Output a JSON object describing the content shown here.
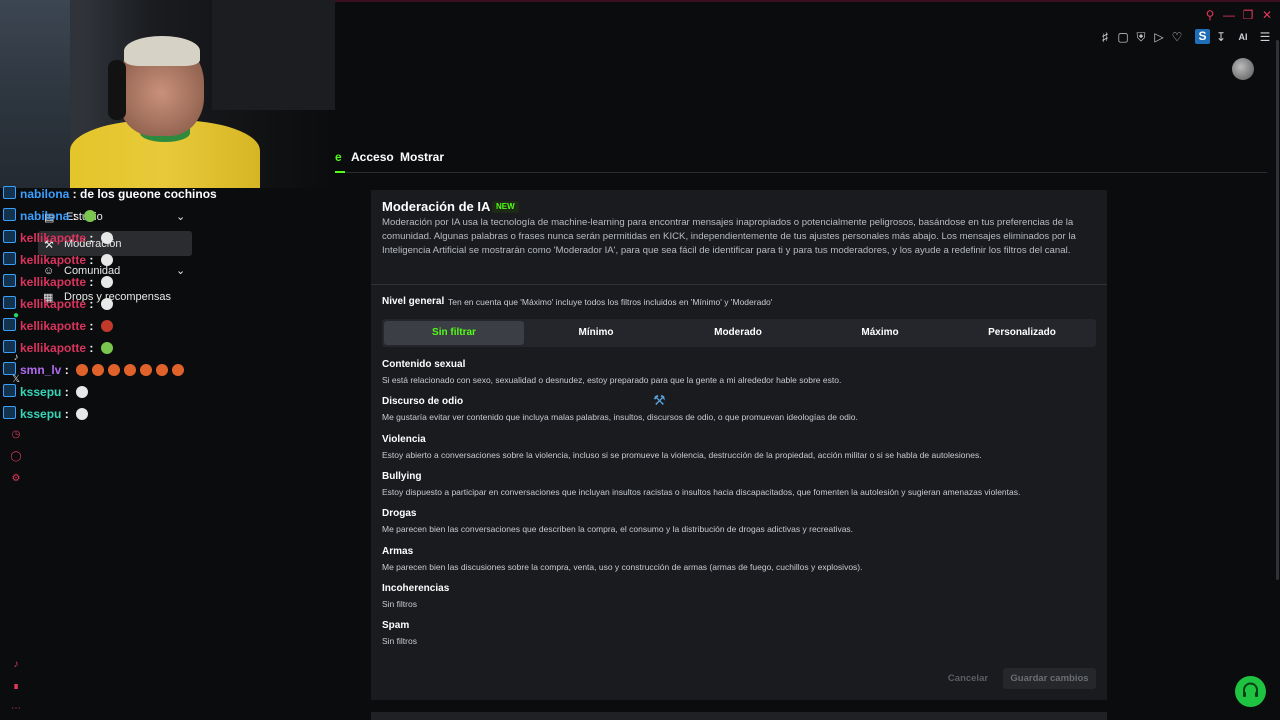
{
  "tabs": {
    "partial": "e",
    "access": "Acceso",
    "show": "Mostrar"
  },
  "window_icons": [
    "search-icon",
    "minimize-icon",
    "restore-icon",
    "close-icon"
  ],
  "toolbar_icons": [
    "bookmark-icon",
    "square-icon",
    "shield-icon",
    "play-icon",
    "heart-icon",
    "s-extension-icon",
    "download-icon",
    "ai-icon",
    "menu-icon"
  ],
  "toolbar": {
    "s_label": "S",
    "ai_label": "AI"
  },
  "chat": [
    {
      "user": "nabilona",
      "color": "#3aa0ff",
      "message": "de los gueone cochinos",
      "emotes": []
    },
    {
      "user": "nabilona",
      "color": "#3aa0ff",
      "message": "",
      "emotes": [
        "green"
      ]
    },
    {
      "user": "kellikapotte",
      "color": "#d9345e",
      "message": "",
      "emotes": [
        "white"
      ]
    },
    {
      "user": "kellikapotte",
      "color": "#d9345e",
      "message": "",
      "emotes": [
        "white"
      ]
    },
    {
      "user": "kellikapotte",
      "color": "#d9345e",
      "message": "",
      "emotes": [
        "white"
      ]
    },
    {
      "user": "kellikapotte",
      "color": "#d9345e",
      "message": "",
      "emotes": [
        "white"
      ]
    },
    {
      "user": "kellikapotte",
      "color": "#d9345e",
      "message": "",
      "emotes": [
        "red"
      ]
    },
    {
      "user": "kellikapotte",
      "color": "#d9345e",
      "message": "",
      "emotes": [
        "green"
      ]
    },
    {
      "user": "smn_lv",
      "color": "#b06cf0",
      "message": "",
      "emotes": [
        "orange",
        "orange",
        "orange",
        "orange",
        "orange",
        "orange",
        "orange"
      ]
    },
    {
      "user": "kssepu",
      "color": "#37d6b9",
      "message": "",
      "emotes": [
        "white"
      ]
    },
    {
      "user": "kssepu",
      "color": "#37d6b9",
      "message": "",
      "emotes": [
        "white"
      ]
    }
  ],
  "side_menu": {
    "streaming": "Estudio",
    "moderation": "Moderación",
    "community": "Comunidad",
    "drops": "Drops y recompensas"
  },
  "panel": {
    "title": "Moderación de IA",
    "badge": "NEW",
    "description": "Moderación por IA usa la tecnología de machine-learning para encontrar mensajes inapropiados o potencialmente peligrosos, basándose en tus preferencias de la comunidad. Algunas palabras o frases nunca serán permitidas en KICK, independientemente de tus ajustes personales más abajo. Los mensajes eliminados por la Inteligencia Artificial se mostrarán como 'Moderador IA', para que sea fácil de identificar para ti y para tus moderadores, y los ayude a redefinir los filtros del canal.",
    "level_label": "Nivel general",
    "level_note": "Ten en cuenta que 'Máximo' incluye todos los filtros incluidos en 'Mínimo' y 'Moderado'",
    "levels": [
      "Sin filtrar",
      "Mínimo",
      "Moderado",
      "Máximo",
      "Personalizado"
    ],
    "selected_level": "Sin filtrar",
    "categories": [
      {
        "title": "Contenido sexual",
        "desc": "Si está relacionado con sexo, sexualidad o desnudez, estoy preparado para que la gente a mi alrededor hable sobre esto."
      },
      {
        "title": "Discurso de odio",
        "desc": "Me gustaría evitar ver contenido que incluya malas palabras, insultos, discursos de odio, o que promuevan ideologías de odio."
      },
      {
        "title": "Violencia",
        "desc": "Estoy abierto a conversaciones sobre la violencia, incluso si se promueve la violencia, destrucción de la propiedad, acción militar o si se habla de autolesiones."
      },
      {
        "title": "Bullying",
        "desc": "Estoy dispuesto a participar en conversaciones que incluyan insultos racistas o insultos hacia discapacitados, que fomenten la autolesión y sugieran amenazas violentas."
      },
      {
        "title": "Drogas",
        "desc": "Me parecen bien las conversaciones que describen la compra, el consumo y la distribución de drogas adictivas y recreativas."
      },
      {
        "title": "Armas",
        "desc": "Me parecen bien las discusiones sobre la compra, venta, uso y construcción de armas (armas de fuego, cuchillos y explosivos)."
      },
      {
        "title": "Incoherencias",
        "desc": "Sin filtros"
      },
      {
        "title": "Spam",
        "desc": "Sin filtros"
      }
    ],
    "cancel": "Cancelar",
    "save": "Guardar cambios"
  },
  "colors": {
    "accent": "#53fc18",
    "panel": "#191b1f",
    "background": "#0b0c0e",
    "support": "#1ec341"
  }
}
